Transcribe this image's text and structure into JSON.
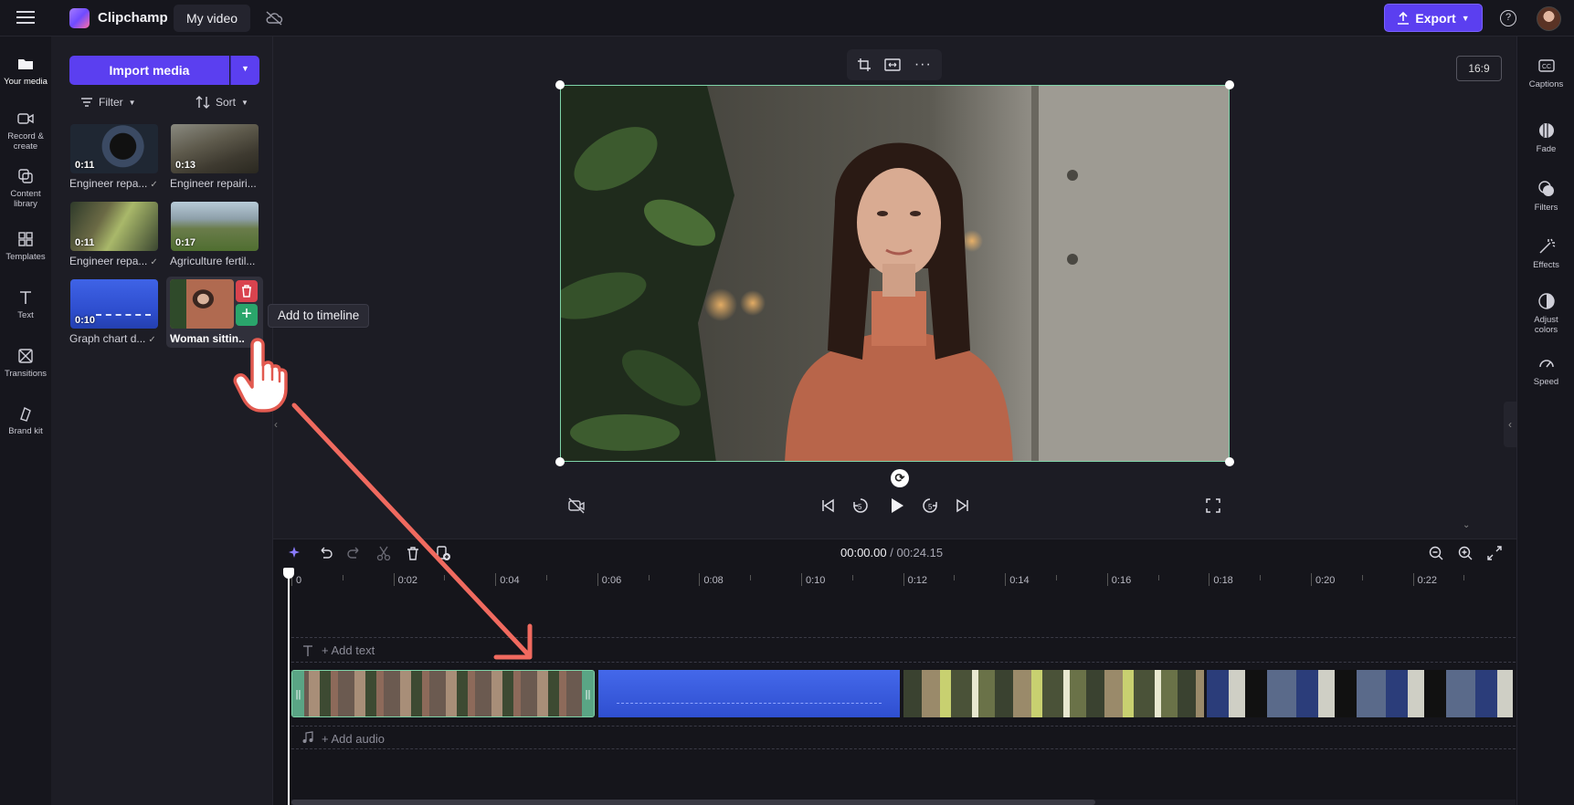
{
  "header": {
    "app_name": "Clipchamp",
    "video_title": "My video",
    "export_label": "Export"
  },
  "left_rail": {
    "items": [
      {
        "label": "Your media",
        "icon": "folder-icon"
      },
      {
        "label": "Record & create",
        "icon": "camera-icon"
      },
      {
        "label": "Content library",
        "icon": "library-icon"
      },
      {
        "label": "Templates",
        "icon": "templates-icon"
      },
      {
        "label": "Text",
        "icon": "text-icon"
      },
      {
        "label": "Transitions",
        "icon": "transitions-icon"
      },
      {
        "label": "Brand kit",
        "icon": "brand-kit-icon"
      }
    ]
  },
  "media": {
    "import_label": "Import media",
    "filter_label": "Filter",
    "sort_label": "Sort",
    "items": [
      {
        "label": "Engineer repa...",
        "duration": "0:11",
        "added": true
      },
      {
        "label": "Engineer repairi...",
        "duration": "0:13",
        "added": false
      },
      {
        "label": "Engineer repa...",
        "duration": "0:11",
        "added": true
      },
      {
        "label": "Agriculture fertil...",
        "duration": "0:17",
        "added": false
      },
      {
        "label": "Graph chart d...",
        "duration": "0:10",
        "added": true
      },
      {
        "label": "Woman sittin...",
        "duration": "",
        "added": true
      }
    ],
    "tooltip": "Add to timeline"
  },
  "preview": {
    "aspect_ratio": "16:9"
  },
  "right_rail": {
    "items": [
      {
        "label": "Captions",
        "icon": "captions-icon"
      },
      {
        "label": "Fade",
        "icon": "fade-icon"
      },
      {
        "label": "Filters",
        "icon": "filters-icon"
      },
      {
        "label": "Effects",
        "icon": "effects-icon"
      },
      {
        "label": "Adjust colors",
        "icon": "adjust-colors-icon"
      },
      {
        "label": "Speed",
        "icon": "speed-icon"
      }
    ]
  },
  "timeline": {
    "current_time": "00:00.00",
    "total_time": "/ 00:24.15",
    "ruler": [
      "0",
      "0:02",
      "0:04",
      "0:06",
      "0:08",
      "0:10",
      "0:12",
      "0:14",
      "0:16",
      "0:18",
      "0:20",
      "0:22"
    ],
    "add_text_label": "+ Add text",
    "add_audio_label": "+ Add audio"
  },
  "colors": {
    "accent": "#5b3ff0",
    "selection": "#7ed3a8",
    "delete": "#d9434e",
    "add": "#2aa56b",
    "annotation_arrow": "#f06a5f"
  }
}
